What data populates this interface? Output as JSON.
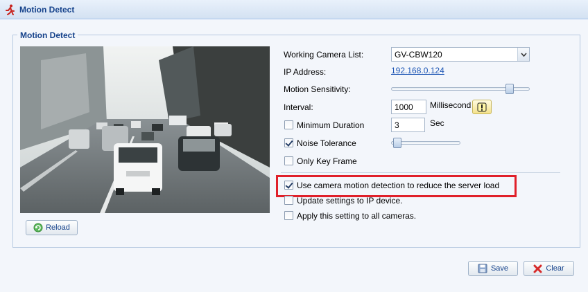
{
  "window": {
    "title": "Motion Detect",
    "icon": "runner-icon"
  },
  "group": {
    "legend": "Motion Detect"
  },
  "preview": {
    "reload_label": "Reload"
  },
  "settings": {
    "working_camera_label": "Working Camera List:",
    "working_camera_value": "GV-CBW120",
    "ip_label": "IP Address:",
    "ip_value": "192.168.0.124",
    "sensitivity_label": "Motion Sensitivity:",
    "sensitivity_level": 0.88,
    "interval_label": "Interval:",
    "interval_value": "1000",
    "interval_unit": "Millisecond",
    "min_duration_label": "Minimum Duration",
    "min_duration_checked": false,
    "min_duration_value": "3",
    "min_duration_unit": "Sec",
    "noise_label": "Noise Tolerance",
    "noise_checked": true,
    "noise_level": 0.03,
    "key_frame_label": "Only Key Frame",
    "key_frame_checked": false,
    "camera_detect_label": "Use camera motion detection to reduce the server load",
    "camera_detect_checked": true,
    "update_ip_label": "Update settings to IP device.",
    "update_ip_checked": false,
    "apply_all_label": "Apply this setting to all cameras.",
    "apply_all_checked": false
  },
  "footer": {
    "save_label": "Save",
    "clear_label": "Clear"
  },
  "colors": {
    "highlight": "#e0202a",
    "title": "#15428b",
    "link": "#1c55b4"
  }
}
